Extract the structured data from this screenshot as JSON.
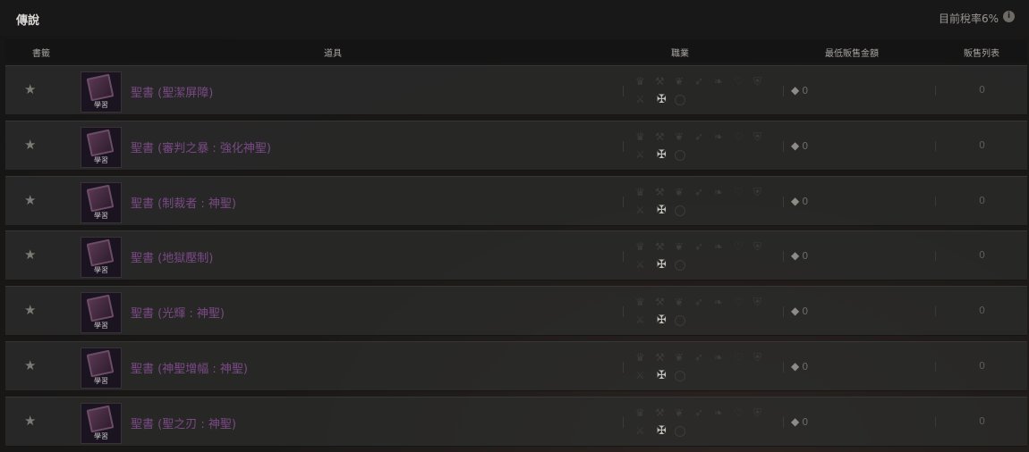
{
  "title": "傳說",
  "tax_label": "目前稅率6%",
  "tax_icon": "i",
  "header": {
    "bookmark": "書籤",
    "item": "道具",
    "class": "職業",
    "min_price": "最低販售金額",
    "listings": "販售列表"
  },
  "rows": [
    {
      "name": "聖書 (聖潔屏障)",
      "badge": "學習",
      "price": "0",
      "listings": "0"
    },
    {
      "name": "聖書 (審判之暴 : 強化神聖)",
      "badge": "學習",
      "price": "0",
      "listings": "0"
    },
    {
      "name": "聖書 (制裁者 : 神聖)",
      "badge": "學習",
      "price": "0",
      "listings": "0"
    },
    {
      "name": "聖書 (地獄壓制)",
      "badge": "學習",
      "price": "0",
      "listings": "0"
    },
    {
      "name": "聖書 (光輝 : 神聖)",
      "badge": "學習",
      "price": "0",
      "listings": "0"
    },
    {
      "name": "聖書 (神聖增幅 : 神聖)",
      "badge": "學習",
      "price": "0",
      "listings": "0"
    },
    {
      "name": "聖書 (聖之刃 : 神聖)",
      "badge": "學習",
      "price": "0",
      "listings": "0"
    }
  ],
  "colors": {
    "item_name": "#7a4a86",
    "background": "#161616"
  },
  "icons": {
    "bookmark": "star-icon",
    "price": "diamond-icon",
    "item": "holy-book-icon",
    "class": "crusader-class-icon"
  }
}
